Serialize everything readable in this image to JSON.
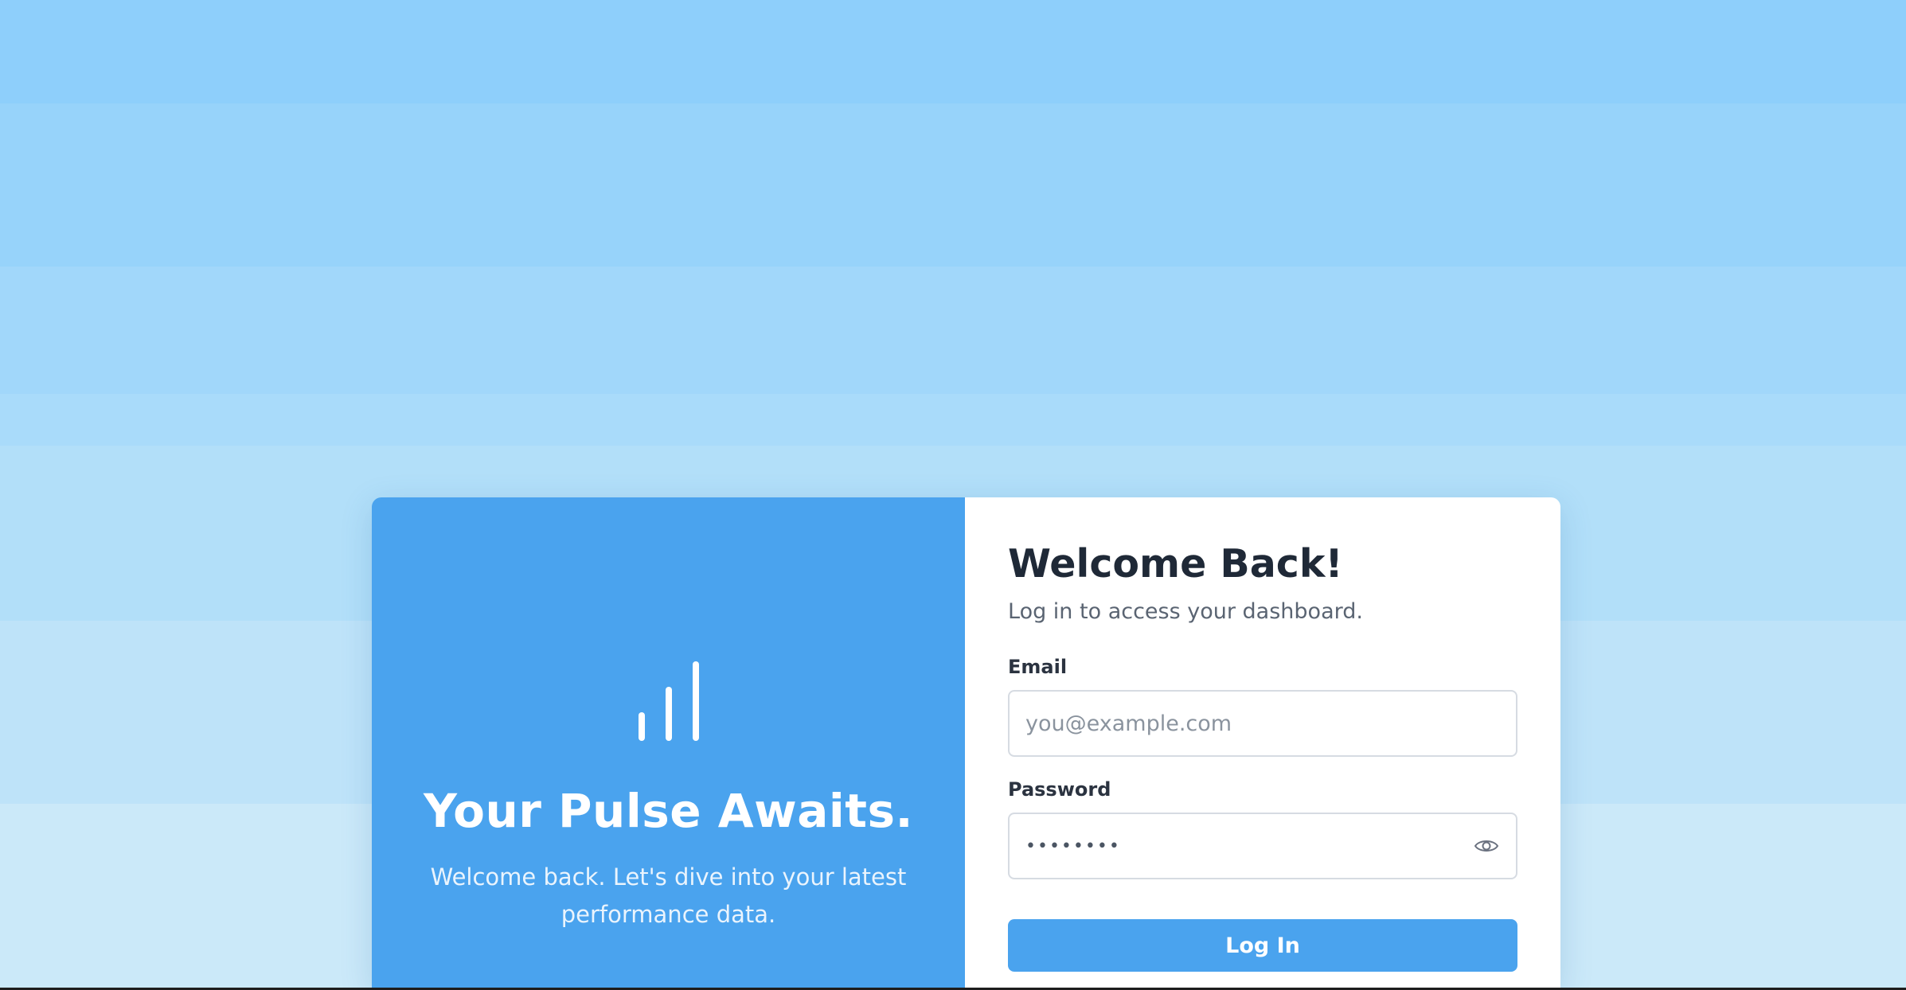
{
  "hero": {
    "icon": "signal-bars-icon",
    "title": "Your Pulse Awaits.",
    "text": "Welcome back. Let's dive into your latest performance data."
  },
  "form": {
    "title": "Welcome Back!",
    "subtitle": "Log in to access your dashboard.",
    "email": {
      "label": "Email",
      "placeholder": "you@example.com",
      "value": ""
    },
    "password": {
      "label": "Password",
      "value": "••••••••",
      "toggle_icon": "eye-icon"
    },
    "submit_label": "Log In"
  },
  "colors": {
    "accent": "#4aa3ee",
    "card_background": "#ffffff",
    "page_background_top": "#8ecffb",
    "page_background_bottom": "#cbe9f9",
    "heading_text": "#1f2937"
  }
}
